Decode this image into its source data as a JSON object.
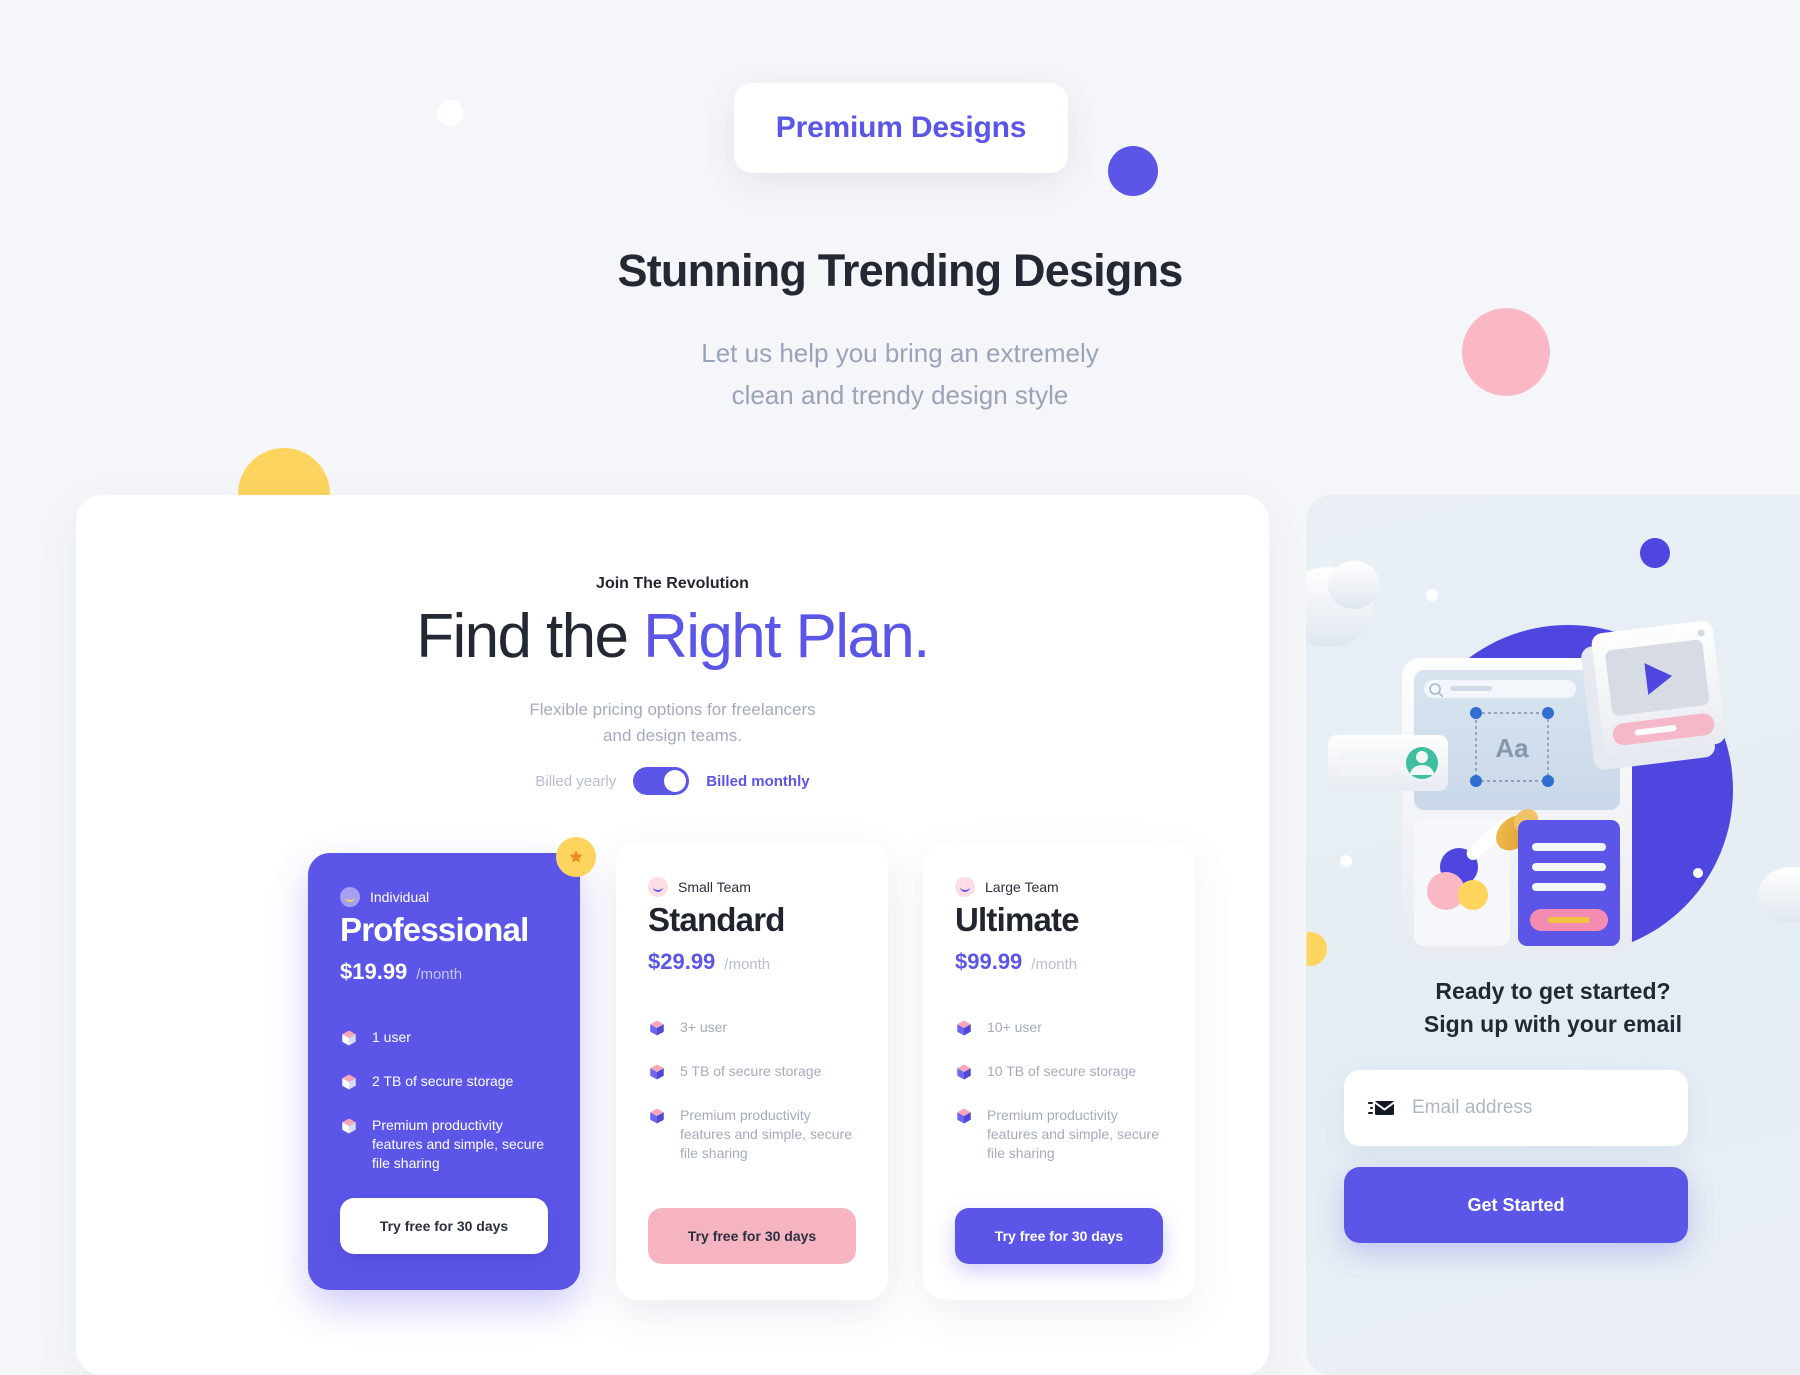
{
  "hero": {
    "badge": "Premium Designs",
    "title": "Stunning Trending Designs",
    "subtitle_line1": "Let us help you bring an extremely",
    "subtitle_line2": "clean and trendy design style"
  },
  "pricing": {
    "eyebrow": "Join The Revolution",
    "title_plain": "Find the ",
    "title_highlight": "Right Plan.",
    "subtitle_line1": "Flexible pricing options for freelancers",
    "subtitle_line2": "and design teams.",
    "billing": {
      "yearly_label": "Billed yearly",
      "monthly_label": "Billed monthly",
      "selected": "Billed monthly"
    },
    "plans": [
      {
        "tag": "Individual",
        "name": "Professional",
        "price": "$19.99",
        "period": "/month",
        "featured": true,
        "features": [
          "1 user",
          "2 TB of secure storage",
          "Premium productivity features and simple, secure file sharing"
        ],
        "cta": "Try free for 30 days"
      },
      {
        "tag": "Small Team",
        "name": "Standard",
        "price": "$29.99",
        "period": "/month",
        "featured": false,
        "features": [
          "3+ user",
          "5 TB of secure storage",
          "Premium productivity features and simple, secure file sharing"
        ],
        "cta": "Try free for 30 days"
      },
      {
        "tag": "Large Team",
        "name": "Ultimate",
        "price": "$99.99",
        "period": "/month",
        "featured": false,
        "features": [
          "10+ user",
          "10 TB of secure storage",
          "Premium productivity features and simple, secure file sharing"
        ],
        "cta": "Try free for 30 days"
      }
    ]
  },
  "signup": {
    "heading_line1": "Ready to get started?",
    "heading_line2": "Sign up with your email",
    "email_placeholder": "Email address",
    "email_value": "",
    "button": "Get Started",
    "illustration_label": "Aa"
  },
  "colors": {
    "accent_purple": "#5B55E8",
    "pink": "#F9B8C4",
    "yellow": "#FDD45E",
    "page_background": "#F4F6F9",
    "panel_background": "#FFFFFF",
    "right_panel_background": "#E8EEF4",
    "heading": "#232833",
    "muted_text": "#A3ABBE"
  }
}
